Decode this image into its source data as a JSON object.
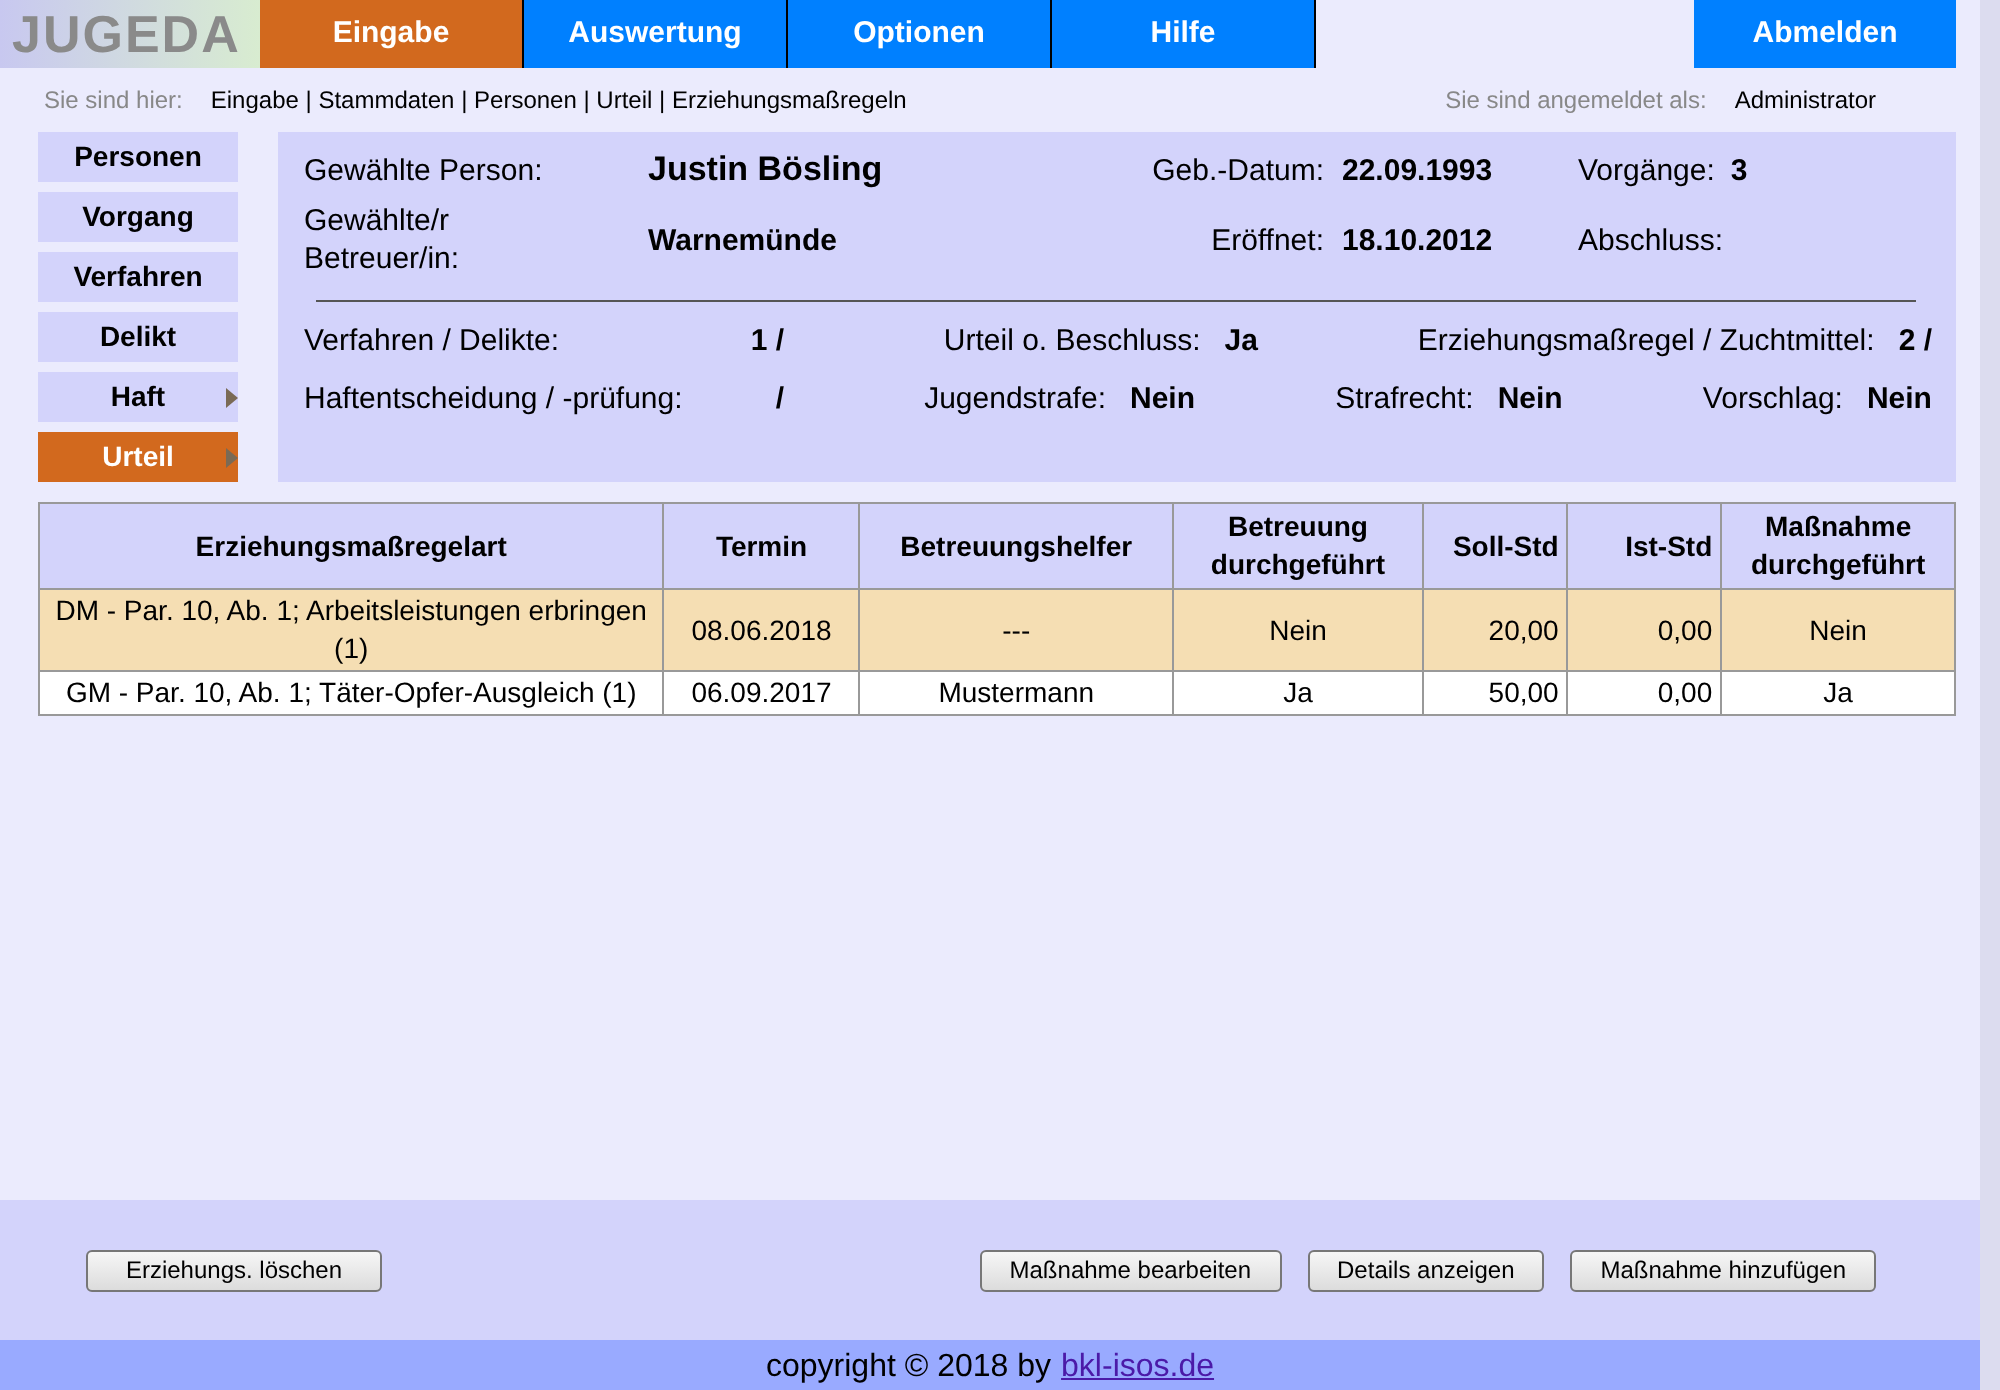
{
  "logo": "JUGEDA",
  "nav": [
    {
      "label": "Eingabe",
      "selected": true
    },
    {
      "label": "Auswertung",
      "selected": false
    },
    {
      "label": "Optionen",
      "selected": false
    },
    {
      "label": "Hilfe",
      "selected": false
    }
  ],
  "logout": "Abmelden",
  "breadcrumb": {
    "label": "Sie sind hier:",
    "path": "Eingabe | Stammdaten | Personen | Urteil | Erziehungsmaßregeln"
  },
  "login": {
    "label": "Sie sind angemeldet als:",
    "user": "Administrator"
  },
  "sidebar": [
    {
      "label": "Personen",
      "selected": false,
      "submenu": false
    },
    {
      "label": "Vorgang",
      "selected": false,
      "submenu": false
    },
    {
      "label": "Verfahren",
      "selected": false,
      "submenu": false
    },
    {
      "label": "Delikt",
      "selected": false,
      "submenu": false
    },
    {
      "label": "Haft",
      "selected": false,
      "submenu": true
    },
    {
      "label": "Urteil",
      "selected": true,
      "submenu": true
    }
  ],
  "info": {
    "person_label": "Gewählte Person:",
    "person": "Justin Bösling",
    "birth_label": "Geb.-Datum:",
    "birth": "22.09.1993",
    "cases_label": "Vorgänge:",
    "cases": "3",
    "caretaker_label": "Gewählte/r Betreuer/in:",
    "caretaker": "Warnemünde",
    "opened_label": "Eröffnet:",
    "opened": "18.10.2012",
    "closed_label": "Abschluss:"
  },
  "stats": [
    [
      {
        "label": "Verfahren / Delikte:",
        "value": "1 /"
      },
      {
        "label": "Urteil o. Beschluss:",
        "value": "Ja"
      },
      {
        "label": "Erziehungsmaßregel / Zuchtmittel:",
        "value": "2 /"
      }
    ],
    [
      {
        "label": "Haftentscheidung / -prüfung:",
        "value": "/"
      },
      {
        "label": "Jugendstrafe:",
        "value": "Nein"
      },
      {
        "label": "Strafrecht:",
        "value": "Nein"
      },
      {
        "label": "Vorschlag:",
        "value": "Nein"
      }
    ]
  ],
  "table": {
    "columns": [
      "Erziehungsmaßregelart",
      "Termin",
      "Betreuungshelfer",
      "Betreuung durchgeführt",
      "Soll-Std",
      "Ist-Std",
      "Maßnahme durchgeführt"
    ],
    "rows": [
      {
        "selected": true,
        "cells": [
          "DM - Par. 10, Ab. 1; Arbeitsleistungen erbringen (1)",
          "08.06.2018",
          "---",
          "Nein",
          "20,00",
          "0,00",
          "Nein"
        ]
      },
      {
        "selected": false,
        "cells": [
          "GM - Par. 10, Ab. 1; Täter-Opfer-Ausgleich (1)",
          "06.09.2017",
          "Mustermann",
          "Ja",
          "50,00",
          "0,00",
          "Ja"
        ]
      }
    ]
  },
  "buttons_left": [
    "Erziehungs. löschen"
  ],
  "buttons_right": [
    "Maßnahme bearbeiten",
    "Details anzeigen",
    "Maßnahme hinzufügen"
  ],
  "footer": {
    "text": "copyright © 2018 by",
    "link": "bkl-isos.de"
  }
}
